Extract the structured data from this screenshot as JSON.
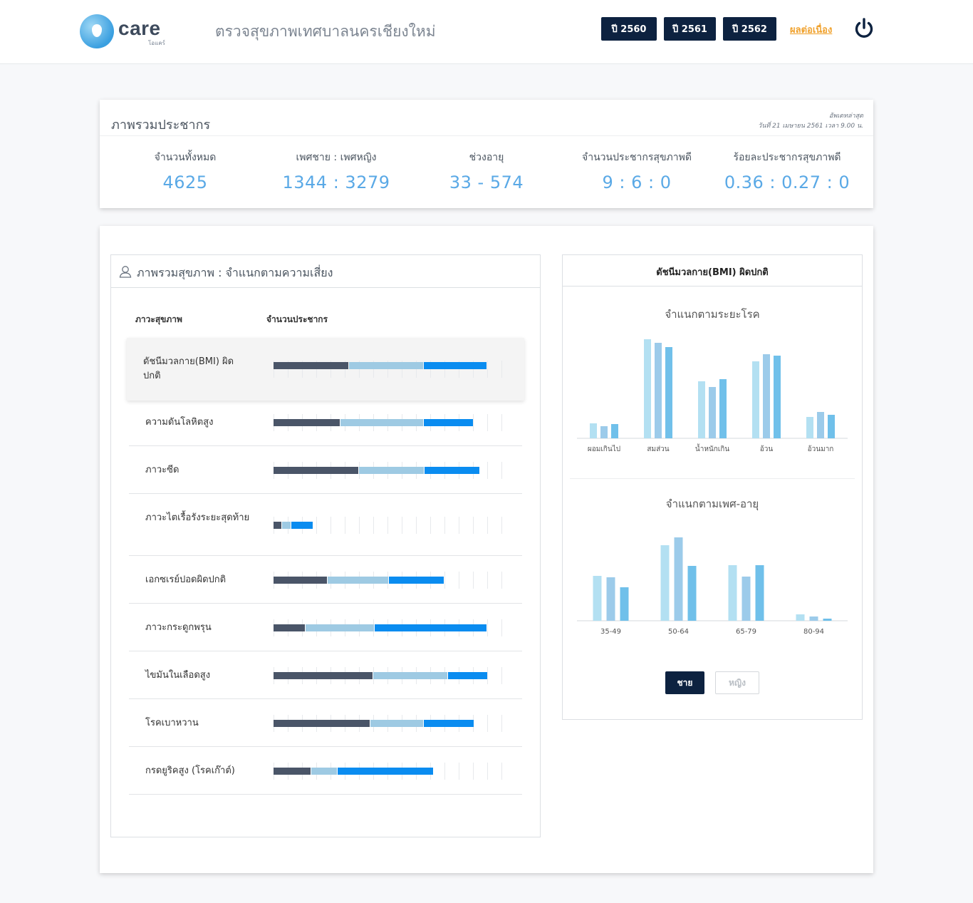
{
  "header": {
    "logo_word": "care",
    "logo_sub": "โอแคร์",
    "title": "ตรวจสุขภาพเทศบาลนครเชียงใหม่",
    "years": [
      "ปี 2560",
      "ปี 2561",
      "ปี 2562"
    ],
    "continue_link": "ผลต่อเนื่อง",
    "power_icon": "power-icon"
  },
  "summary": {
    "title": "ภาพรวมประชากร",
    "updated_label": "อัพเดทล่าสุด",
    "updated_date": "วันที่ 21 เมษายน 2561 เวลา 9.00 น.",
    "stats": [
      {
        "label": "จำนวนทั้งหมด",
        "value": "4625"
      },
      {
        "label": "เพศชาย : เพศหญิง",
        "value": "1344 : 3279"
      },
      {
        "label": "ช่วงอายุ",
        "value": "33 - 574"
      },
      {
        "label": "จำนวนประชากรสุขภาพดี",
        "value": "9 : 6 : 0"
      },
      {
        "label": "ร้อยละประชากรสุขภาพดี",
        "value": "0.36 : 0.27 : 0"
      }
    ]
  },
  "risk": {
    "title": "ภาพรวมสุขภาพ : จำแนกตามความเสี่ยง",
    "col_condition": "ภาวะสุขภาพ",
    "col_population": "จำนวนประชากร",
    "colors": {
      "dark": "#4a5568",
      "light": "#9ecae3",
      "blue": "#0a8cf0"
    },
    "rows": [
      {
        "label": "ดัชนีมวลกาย(BMI) ผิดปกติ",
        "segments": [
          34,
          33.5,
          28.5
        ]
      },
      {
        "label": "ความดันโลหิตสูง",
        "segments": [
          30,
          37.5,
          22.5
        ]
      },
      {
        "label": "ภาวะซีด",
        "segments": [
          38.5,
          29.5,
          25
        ]
      },
      {
        "label": "ภาวะไตเรื้อรังระยะสุดท้าย",
        "segments": [
          4,
          4,
          10
        ]
      },
      {
        "label": "เอกซเรย์ปอดผิดปกติ",
        "segments": [
          24.5,
          27.5,
          25
        ]
      },
      {
        "label": "ภาวะกระดูกพรุน",
        "segments": [
          14.5,
          31,
          50.5
        ]
      },
      {
        "label": "ไขมันในเลือดสูง",
        "segments": [
          45,
          33.5,
          18
        ]
      },
      {
        "label": "โรคเบาหวาน",
        "segments": [
          43.5,
          24,
          23
        ]
      },
      {
        "label": "กรดยูริคสูง (โรคเก๊าต์)",
        "segments": [
          17,
          12,
          43
        ]
      }
    ]
  },
  "bmi": {
    "title": "ดัชนีมวลกาย(BMI) ผิดปกติ",
    "chart_by_level_title": "จำแนกตามระยะโรค",
    "chart_by_sex_age_title": "จำแนกตามเพศ-อายุ",
    "toggle_male": "ชาย",
    "toggle_female": "หญิง",
    "series_colors": [
      "#b3e0f2",
      "#9ccbea",
      "#70c0ea"
    ]
  },
  "chart_data": [
    {
      "type": "bar",
      "title": "จำแนกตามระยะโรค",
      "categories": [
        "ผอมเกินไป",
        "สมส่วน",
        "น้ำหนักเกิน",
        "อ้วน",
        "อ้วนมาก"
      ],
      "series": [
        {
          "values": [
            21,
            139,
            80,
            108,
            30
          ]
        },
        {
          "values": [
            17,
            134,
            72,
            118,
            37
          ]
        },
        {
          "values": [
            20,
            128,
            83,
            116,
            33
          ]
        }
      ],
      "ylim": [
        0,
        150
      ]
    },
    {
      "type": "bar",
      "title": "จำแนกตามเพศ-อายุ",
      "categories": [
        "35-49",
        "50-64",
        "65-79",
        "80-94"
      ],
      "series": [
        {
          "values": [
            63,
            106,
            78,
            9
          ]
        },
        {
          "values": [
            61,
            117,
            62,
            6
          ]
        },
        {
          "values": [
            47,
            77,
            78,
            3
          ]
        }
      ],
      "ylim": [
        0,
        130
      ]
    }
  ]
}
